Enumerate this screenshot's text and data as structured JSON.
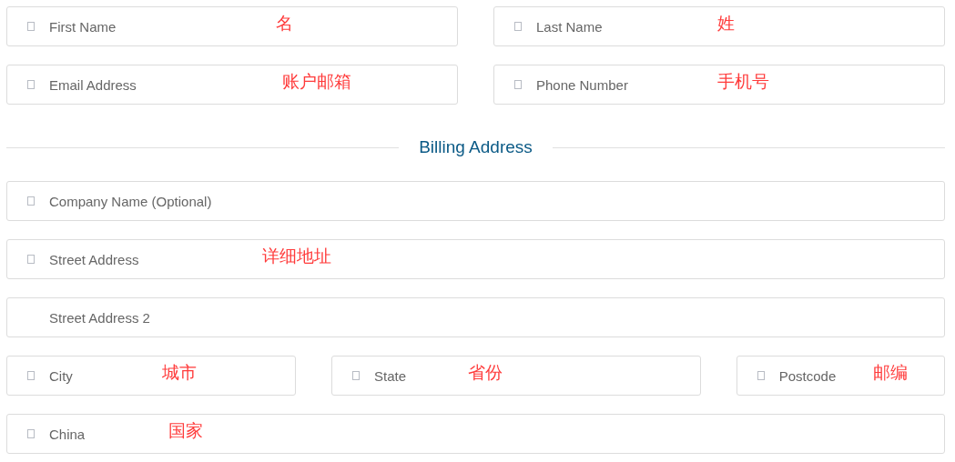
{
  "contact_rows": [
    [
      {
        "placeholder": "First Name",
        "has_icon": true,
        "annotation": "名"
      },
      {
        "placeholder": "Last Name",
        "has_icon": true,
        "annotation": "姓"
      }
    ],
    [
      {
        "placeholder": "Email Address",
        "has_icon": true,
        "annotation": "账户邮箱"
      },
      {
        "placeholder": "Phone Number",
        "has_icon": true,
        "annotation": "手机号"
      }
    ]
  ],
  "section_title": "Billing Address",
  "billing_rows": [
    [
      {
        "placeholder": "Company Name (Optional)",
        "has_icon": true
      }
    ],
    [
      {
        "placeholder": "Street Address",
        "has_icon": true,
        "annotation": "详细地址"
      }
    ],
    [
      {
        "placeholder": "Street Address 2",
        "has_icon": false
      }
    ],
    [
      {
        "placeholder": "City",
        "has_icon": true,
        "annotation": "城市"
      },
      {
        "placeholder": "State",
        "has_icon": true,
        "annotation": "省份"
      },
      {
        "placeholder": "Postcode",
        "has_icon": true,
        "annotation": "邮编"
      }
    ],
    [
      {
        "value": "China",
        "has_icon": true,
        "annotation": "国家"
      }
    ]
  ]
}
